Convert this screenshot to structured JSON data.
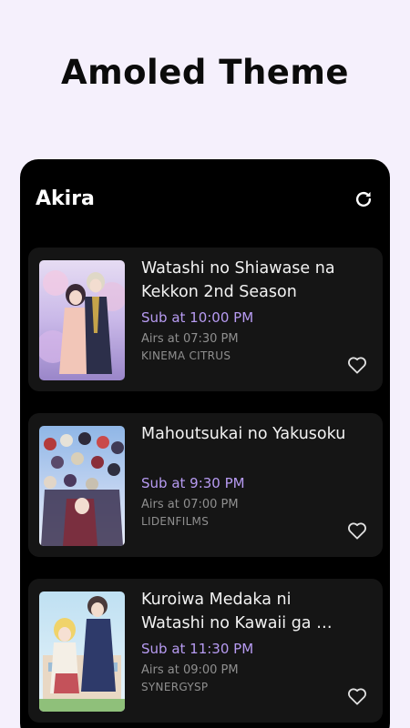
{
  "headline": "Amoled Theme",
  "app": {
    "title": "Akira",
    "refresh_icon": "refresh-icon"
  },
  "colors": {
    "background": "#f5f0fc",
    "panel": "#000000",
    "card": "#151515",
    "accent": "#b79bf2",
    "muted": "#8f8f8f"
  },
  "anime": [
    {
      "title": "Watashi no Shiawase na Kekkon 2nd Season",
      "sub": "Sub at 10:00 PM",
      "airs": "Airs at 07:30 PM",
      "studio": "KINEMA CITRUS",
      "favorite_icon": "heart-outline-icon"
    },
    {
      "title": "Mahoutsukai no Yakusoku",
      "sub": "Sub at 9:30 PM",
      "airs": "Airs at 07:00 PM",
      "studio": "LIDENFILMS",
      "favorite_icon": "heart-outline-icon"
    },
    {
      "title": "Kuroiwa Medaka ni Watashi no Kawaii ga …",
      "sub": "Sub at 11:30 PM",
      "airs": "Airs at 09:00 PM",
      "studio": "SYNERGYSP",
      "favorite_icon": "heart-outline-icon"
    }
  ]
}
